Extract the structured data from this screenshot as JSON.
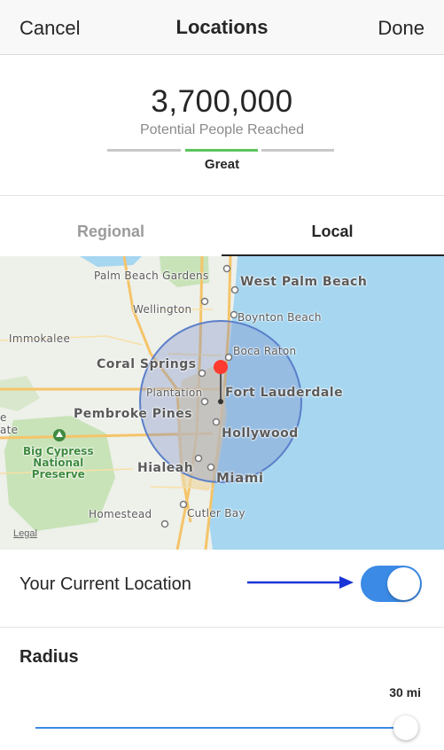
{
  "navbar": {
    "cancel": "Cancel",
    "title": "Locations",
    "done": "Done"
  },
  "reach": {
    "number": "3,700,000",
    "label": "Potential People Reached",
    "quality": "Great",
    "colors": {
      "active": "#5cc45c",
      "inactive": "#c8c8c8"
    }
  },
  "tabs": [
    {
      "label": "Regional",
      "selected": false
    },
    {
      "label": "Local",
      "selected": true
    }
  ],
  "map": {
    "places": {
      "palm_beach_gardens": "Palm Beach Gardens",
      "west_palm_beach": "West Palm Beach",
      "wellington": "Wellington",
      "boynton_beach": "Boynton Beach",
      "immokalee": "Immokalee",
      "boca_raton": "Boca Raton",
      "coral_springs": "Coral Springs",
      "plantation": "Plantation",
      "fort_lauderdale": "Fort Lauderdale",
      "pembroke_pines": "Pembroke Pines",
      "hollywood": "Hollywood",
      "big_cypress": "Big Cypress\nNational\nPreserve",
      "hialeah": "Hialeah",
      "miami": "Miami",
      "homestead": "Homestead",
      "cutler_bay": "Cutler Bay",
      "partial_left": "e",
      "partial_left2": "ate"
    },
    "legal": "Legal",
    "pin_color": "#ff3b30",
    "water_color": "#a6d6f0",
    "radius_fill": "rgba(120,140,200,0.35)"
  },
  "current_location": {
    "label": "Your Current Location",
    "enabled": true,
    "toggle_color": "#3b8ae6"
  },
  "radius": {
    "title": "Radius",
    "value": "30 mi",
    "fraction": 1.0
  }
}
